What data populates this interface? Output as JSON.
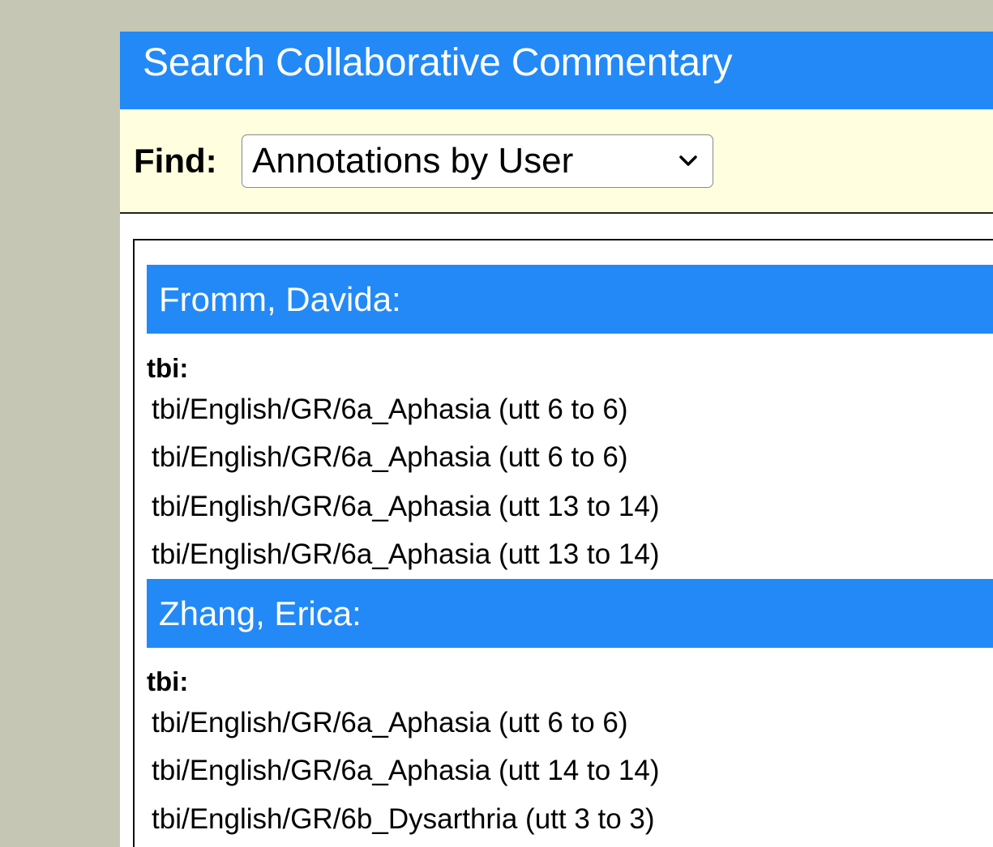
{
  "header": {
    "title": "Search Collaborative Commentary"
  },
  "find": {
    "label": "Find:",
    "selected": "Annotations by User"
  },
  "users": [
    {
      "name": "Fromm, Davida:",
      "corpora": [
        {
          "label": "tbi:",
          "links": [
            "tbi/English/GR/6a_Aphasia (utt 6 to 6)",
            "tbi/English/GR/6a_Aphasia (utt 6 to 6)",
            "tbi/English/GR/6a_Aphasia (utt 13 to 14)",
            "tbi/English/GR/6a_Aphasia (utt 13 to 14)"
          ]
        }
      ]
    },
    {
      "name": "Zhang, Erica:",
      "corpora": [
        {
          "label": "tbi:",
          "links": [
            "tbi/English/GR/6a_Aphasia (utt 6 to 6)",
            "tbi/English/GR/6a_Aphasia (utt 14 to 14)",
            "tbi/English/GR/6b_Dysarthria (utt 3 to 3)"
          ]
        }
      ]
    }
  ],
  "colors": {
    "accent": "#2389f7",
    "page_background": "#c5c6b4",
    "find_bar_background": "#fffedf"
  },
  "icons": {
    "select_arrow": "chevron-down-icon"
  }
}
